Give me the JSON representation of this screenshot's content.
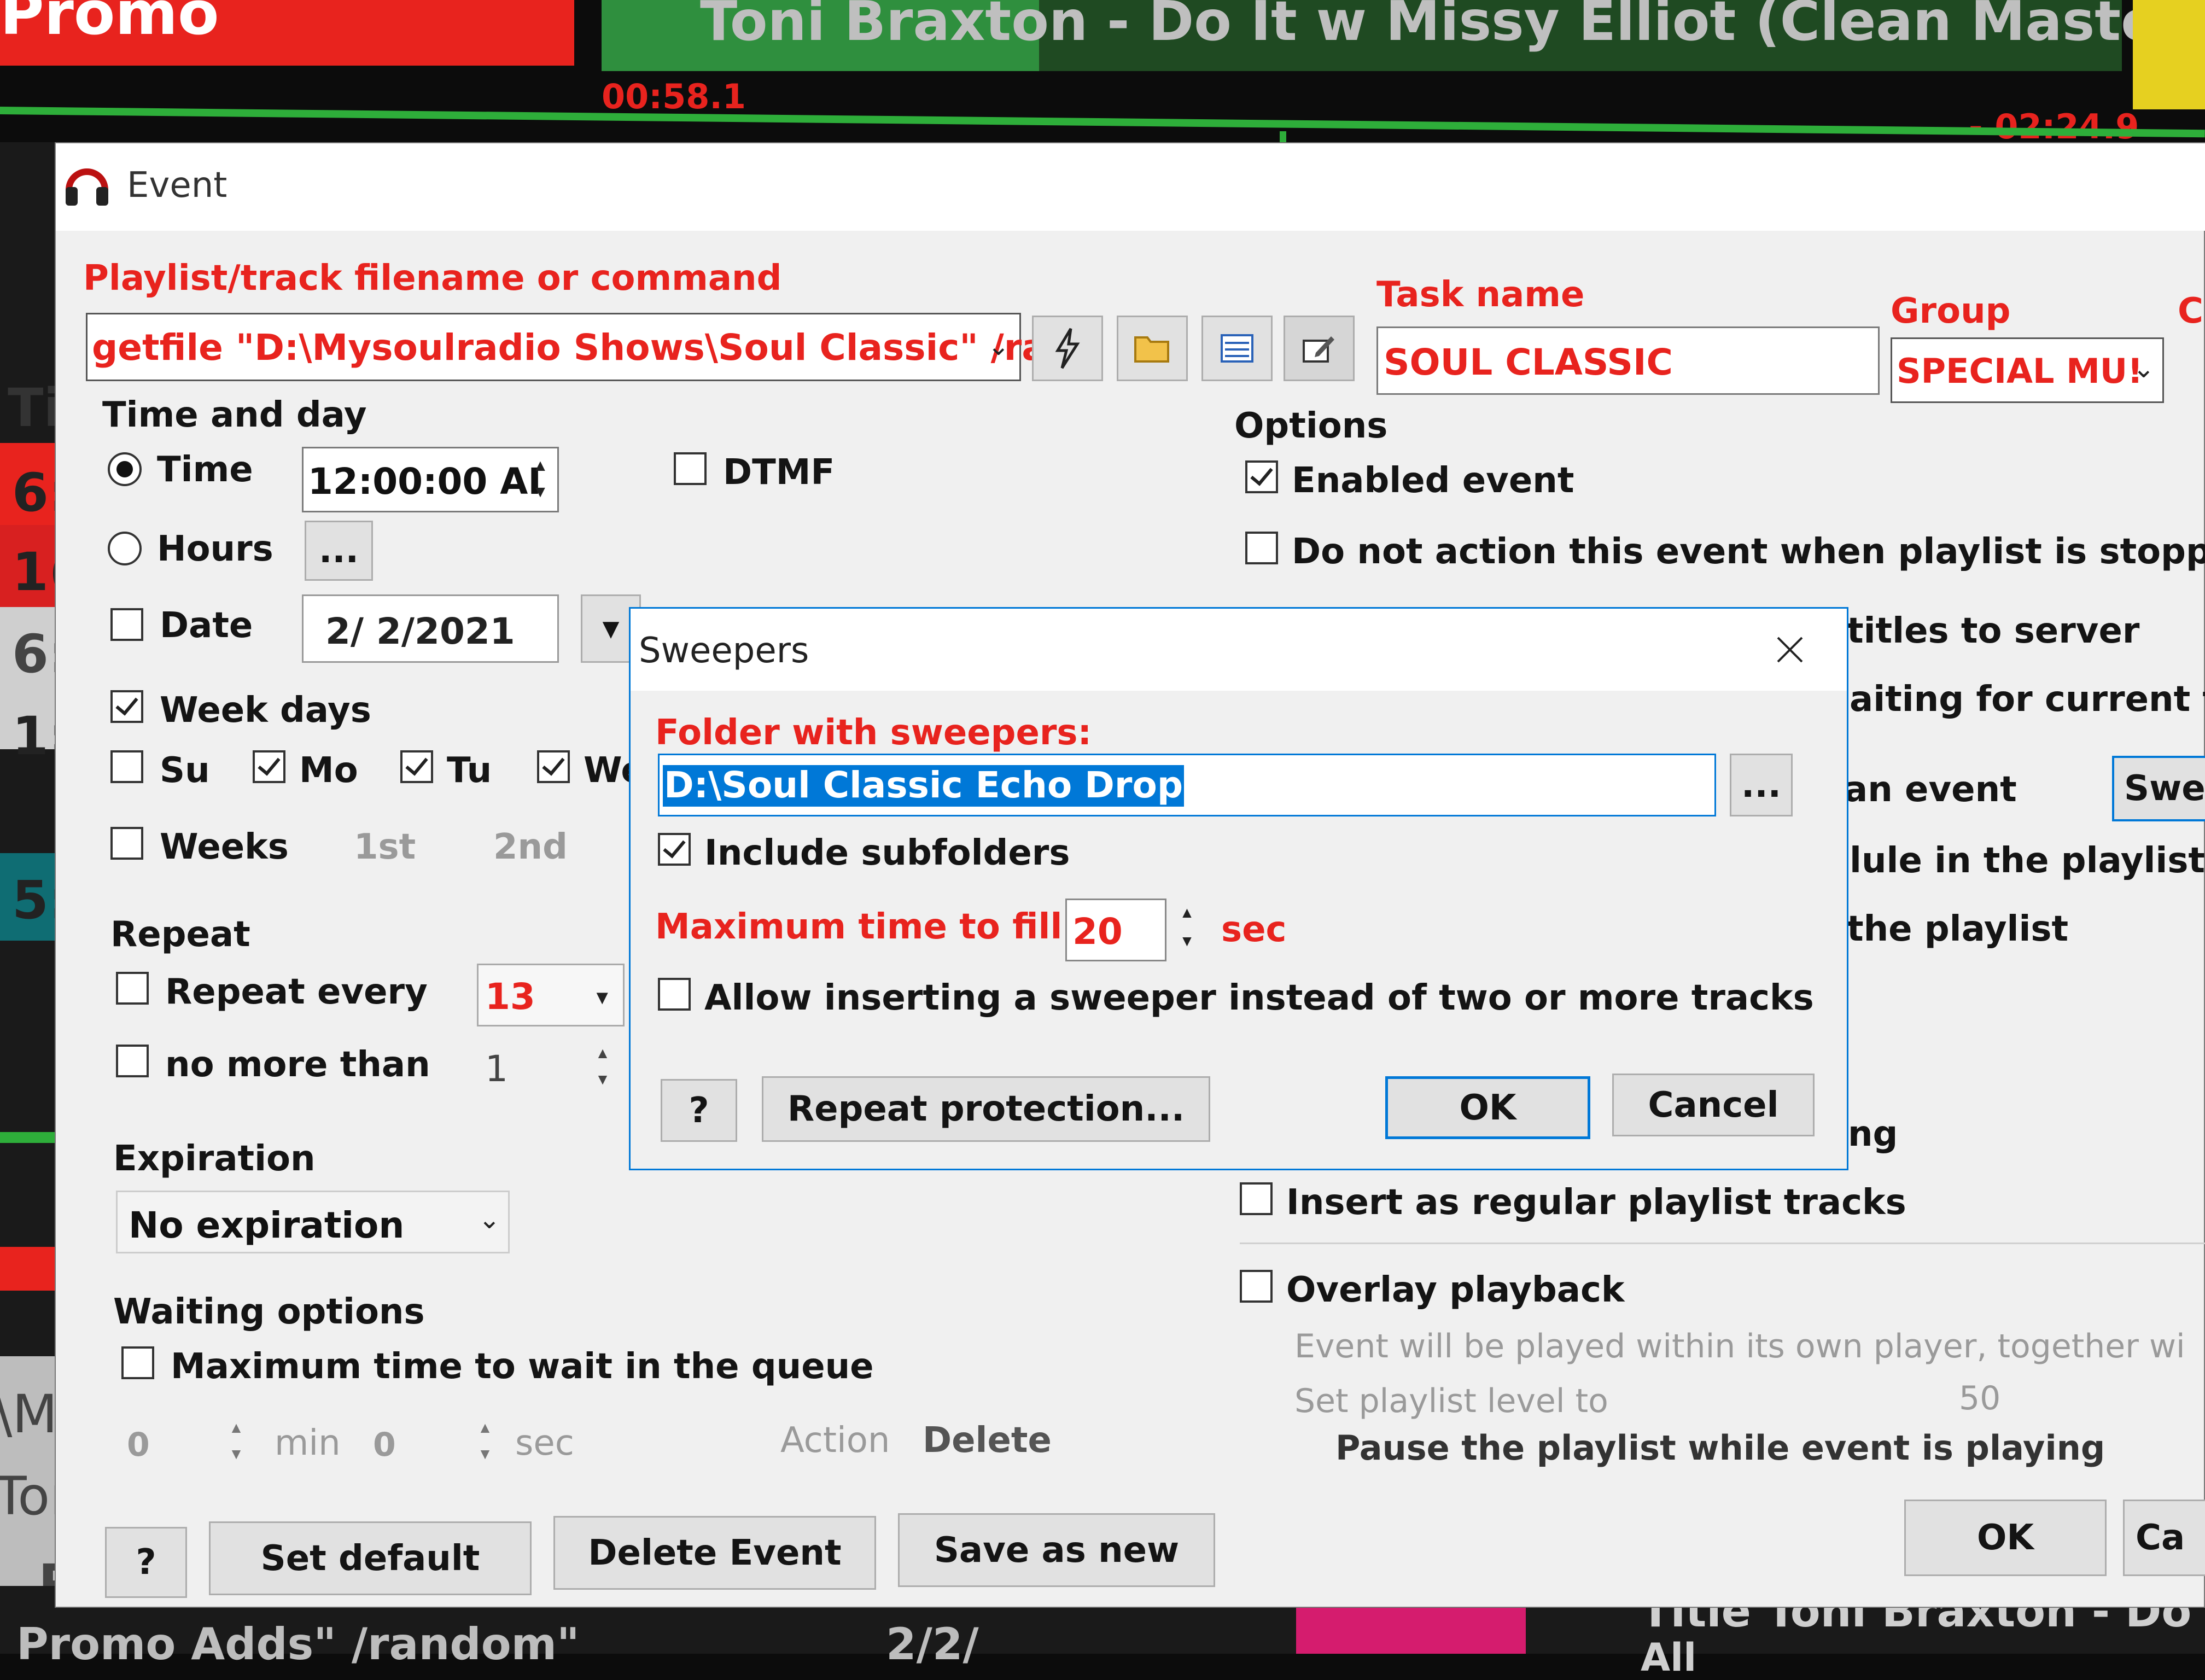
{
  "background": {
    "top_red_label": "Promo",
    "now_playing_title": "Toni Braxton - Do It w Missy Elliot (Clean Master)",
    "elapsed_time": "00:58.1",
    "remaining_time": "- 02:24.9",
    "left_col": [
      "Ti",
      "6:",
      "1(",
      "6:",
      "1:",
      "5:"
    ],
    "left_bottom": [
      "\\My",
      "Ton",
      "R"
    ],
    "bottom_title": "Title Toni Braxton - Do It",
    "bottom_cmd": "Promo Adds\" /random\"",
    "bottom_date": "2/2/",
    "bottom_misc": "All"
  },
  "event_dialog": {
    "title": "Event",
    "playlist_label": "Playlist/track filename or command",
    "playlist_value": "getfile \"D:\\Mysoulradio Shows\\Soul Classic\" /ra",
    "task_name_label": "Task name",
    "task_name_value": "SOUL CLASSIC",
    "group_label": "Group",
    "group_value": "SPECIAL MU!",
    "c_label": "C",
    "time_and_day_label": "Time and day",
    "time_label": "Time",
    "time_value": "12:00:00 AI",
    "dtmf_label": "DTMF",
    "hours_label": "Hours",
    "hours_button": "...",
    "date_label": "Date",
    "date_value": "2/  2/2021",
    "week_days_label": "Week days",
    "days": [
      "Su",
      "Mo",
      "Tu",
      "We"
    ],
    "weeks_label": "Weeks",
    "weeks": [
      "1st",
      "2nd"
    ],
    "repeat_label": "Repeat",
    "repeat_every_label": "Repeat every",
    "repeat_every_value": "13",
    "no_more_than_label": "no more than",
    "no_more_than_value": "1",
    "expiration_label": "Expiration",
    "expiration_value": "No expiration",
    "waiting_label": "Waiting options",
    "max_wait_label": "Maximum time to wait in the queue",
    "wait_min_value": "0",
    "wait_min_unit": "min",
    "wait_sec_value": "0",
    "wait_sec_unit": "sec",
    "action_label": "Action",
    "action_value": "Delete",
    "options_label": "Options",
    "enabled_event_label": "Enabled event",
    "do_not_action_label": "Do not action this event when playlist is stopped",
    "titles_to_server_fragment": "titles to server",
    "waiting_current_fragment": "aiting for current trac",
    "an_event_fragment": "an event",
    "sweepers_button_fragment": "Swee",
    "schedule_fragment": "lule in the playlist, enc",
    "the_playlist_fragment": "the playlist",
    "ing_fragment": "ing",
    "insert_regular_label": "Insert as regular playlist tracks",
    "overlay_label": "Overlay playback",
    "overlay_note": "Event will be played within its own player, together wi",
    "playlist_level_label": "Set playlist level to",
    "playlist_level_value": "50",
    "pause_playlist_label": "Pause the playlist while event is playing",
    "help_button": "?",
    "set_default_button": "Set default",
    "delete_event_button": "Delete Event",
    "save_as_new_button": "Save as new",
    "ok_button": "OK",
    "cancel_fragment": "Ca"
  },
  "sweepers_dialog": {
    "title": "Sweepers",
    "folder_label": "Folder with sweepers:",
    "folder_value": "D:\\Soul Classic Echo Drop",
    "browse_button": "...",
    "include_subfolders_label": "Include subfolders",
    "max_time_label": "Maximum time to fill:",
    "max_time_value": "20",
    "max_time_unit": "sec",
    "allow_inserting_label": "Allow inserting a sweeper instead of two or more tracks",
    "help_button": "?",
    "repeat_protection_button": "Repeat protection...",
    "ok_button": "OK",
    "cancel_button": "Cancel"
  },
  "colors": {
    "accent_red": "#e8231e",
    "selection_blue": "#0078d7",
    "dialog_bg": "#f0f0f0",
    "green_bar": "#2eae3a"
  }
}
